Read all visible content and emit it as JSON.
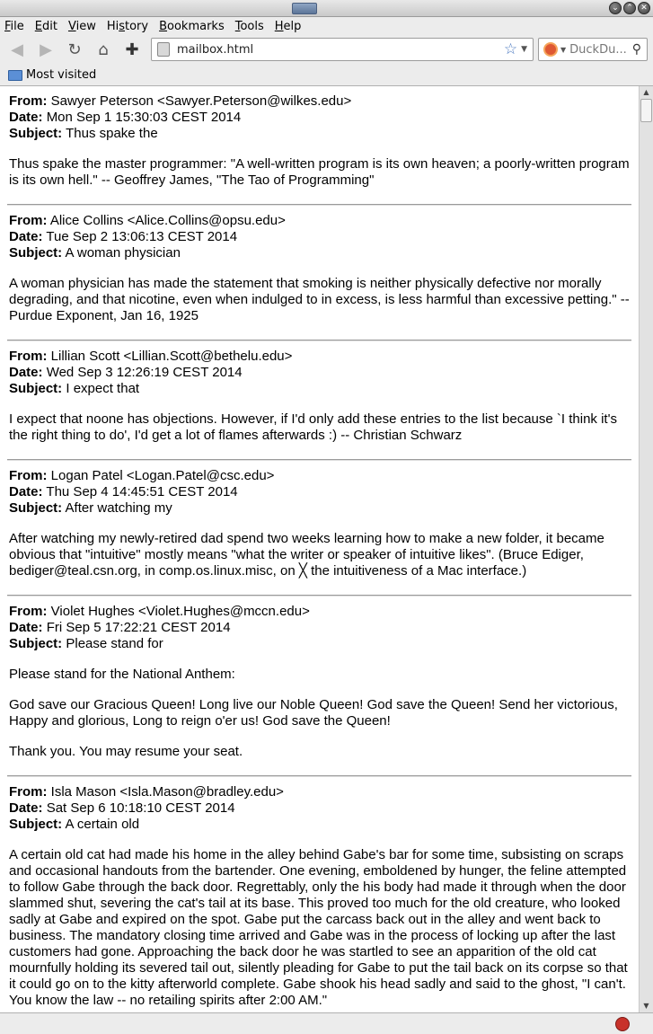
{
  "window": {
    "close_glyphs": [
      "⌄",
      "⌃",
      "✕"
    ]
  },
  "menu": [
    "File",
    "Edit",
    "View",
    "History",
    "Bookmarks",
    "Tools",
    "Help"
  ],
  "menu_accel": [
    "F",
    "E",
    "V",
    "s",
    "B",
    "T",
    "H"
  ],
  "nav": {
    "url": "mailbox.html",
    "search_placeholder": "DuckDu..."
  },
  "bookmarks": {
    "most_visited": "Most visited"
  },
  "labels": {
    "from": "From:",
    "date": "Date:",
    "subject": "Subject:"
  },
  "emails": [
    {
      "from": "Sawyer Peterson <Sawyer.Peterson@wilkes.edu>",
      "date": "Mon Sep 1 15:30:03 CEST 2014",
      "subject": "Thus spake the",
      "body": [
        "Thus spake the master programmer: \"A well-written program is its own heaven; a poorly-written program is its own hell.\" -- Geoffrey James, \"The Tao of Programming\""
      ]
    },
    {
      "from": "Alice Collins <Alice.Collins@opsu.edu>",
      "date": "Tue Sep 2 13:06:13 CEST 2014",
      "subject": "A woman physician",
      "body": [
        "A woman physician has made the statement that smoking is neither physically defective nor morally degrading, and that nicotine, even when indulged to in excess, is less harmful than excessive petting.\" -- Purdue Exponent, Jan 16, 1925"
      ]
    },
    {
      "from": "Lillian Scott <Lillian.Scott@bethelu.edu>",
      "date": "Wed Sep 3 12:26:19 CEST 2014",
      "subject": "I expect that",
      "body": [
        "I expect that noone has objections. However, if I'd only add these entries to the list because `I think it's the right thing to do', I'd get a lot of flames afterwards :) -- Christian Schwarz"
      ]
    },
    {
      "from": "Logan Patel <Logan.Patel@csc.edu>",
      "date": "Thu Sep 4 14:45:51 CEST 2014",
      "subject": "After watching my",
      "body": [
        "After watching my newly-retired dad spend two weeks learning how to make a new folder, it became obvious that \"intuitive\" mostly means \"what the writer or speaker of intuitive likes\". (Bruce Ediger, bediger@teal.csn.org, in comp.os.linux.misc, on ╳ the intuitiveness of a Mac interface.)"
      ]
    },
    {
      "from": "Violet Hughes <Violet.Hughes@mccn.edu>",
      "date": "Fri Sep 5 17:22:21 CEST 2014",
      "subject": "Please stand for",
      "body": [
        "Please stand for the National Anthem:",
        "God save our Gracious Queen! Long live our Noble Queen! God save the Queen! Send her victorious, Happy and glorious, Long to reign o'er us! God save the Queen!",
        "Thank you. You may resume your seat."
      ]
    },
    {
      "from": "Isla Mason <Isla.Mason@bradley.edu>",
      "date": "Sat Sep 6 10:18:10 CEST 2014",
      "subject": "A certain old",
      "body": [
        "A certain old cat had made his home in the alley behind Gabe's bar for some time, subsisting on scraps and occasional handouts from the bartender. One evening, emboldened by hunger, the feline attempted to follow Gabe through the back door. Regrettably, only the his body had made it through when the door slammed shut, severing the cat's tail at its base. This proved too much for the old creature, who looked sadly at Gabe and expired on the spot. Gabe put the carcass back out in the alley and went back to business. The mandatory closing time arrived and Gabe was in the process of locking up after the last customers had gone. Approaching the back door he was startled to see an apparition of the old cat mournfully holding its severed tail out, silently pleading for Gabe to put the tail back on its corpse so that it could go on to the kitty afterworld complete. Gabe shook his head sadly and said to the ghost, \"I can't. You know the law -- no retailing spirits after 2:00 AM.\""
      ]
    }
  ]
}
